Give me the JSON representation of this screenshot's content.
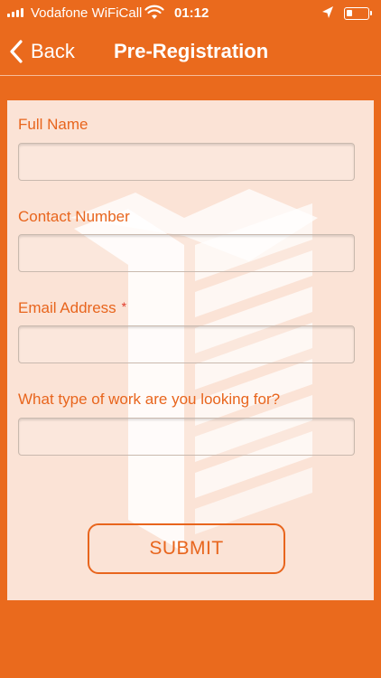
{
  "status_bar": {
    "carrier": "Vodafone WiFiCall",
    "time": "01:12"
  },
  "nav": {
    "back_label": "Back",
    "title": "Pre-Registration"
  },
  "form": {
    "fields": [
      {
        "label": "Full Name",
        "value": "",
        "required": false
      },
      {
        "label": "Contact Number",
        "value": "",
        "required": false
      },
      {
        "label": "Email Address",
        "value": "",
        "required": true
      },
      {
        "label": "What type of work are you looking for?",
        "value": "",
        "required": false
      }
    ],
    "required_marker": "*",
    "submit_label": "SUBMIT"
  },
  "colors": {
    "background": "#ea6a1d",
    "card": "#fbe3d6",
    "accent": "#e8651d"
  },
  "icons": [
    "signal-icon",
    "wifi-icon",
    "location-arrow-icon",
    "battery-icon",
    "chevron-left-icon",
    "logo-watermark"
  ]
}
